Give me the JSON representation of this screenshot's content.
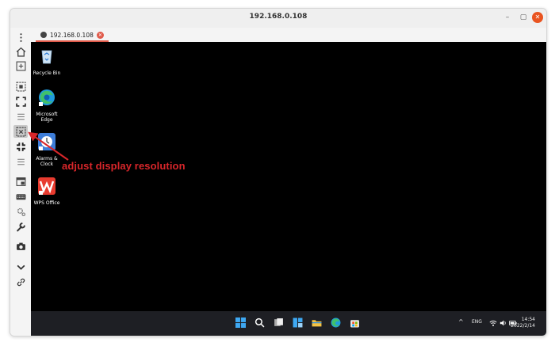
{
  "window": {
    "title": "192.168.0.108"
  },
  "tab": {
    "label": "192.168.0.108"
  },
  "sidebar": {
    "icons": [
      "more-vert-icon",
      "home-icon",
      "add-window-icon",
      "fit-screen-icon",
      "fullscreen-icon",
      "menu-lines-icon",
      "display-resolution-icon",
      "actual-size-icon",
      "menu-lines-icon",
      "window-mode-icon",
      "keyboard-icon",
      "settings-icon",
      "wrench-icon",
      "camera-icon",
      "chevron-down-icon",
      "link-icon"
    ]
  },
  "desktop": {
    "icons": [
      {
        "label": "Recycle Bin"
      },
      {
        "label": "Microsoft Edge"
      },
      {
        "label": "Alarms & Clock"
      },
      {
        "label": "WPS Office"
      }
    ]
  },
  "taskbar": {
    "apps": [
      "windows-start-icon",
      "search-icon",
      "task-view-icon",
      "widgets-icon",
      "file-explorer-icon",
      "edge-icon",
      "store-icon"
    ],
    "tray": {
      "chevron": "^",
      "lang": "ENG",
      "time": "14:54",
      "date": "2022/2/14"
    }
  },
  "annotation": {
    "text": "adjust display resolution",
    "color": "#d8262a"
  }
}
